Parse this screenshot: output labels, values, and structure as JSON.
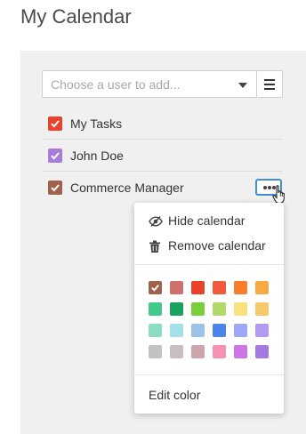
{
  "header": {
    "title": "My Calendar"
  },
  "user_picker": {
    "placeholder": "Choose a user to add..."
  },
  "calendars": [
    {
      "label": "My Tasks",
      "color": "#e8412c",
      "checked": true
    },
    {
      "label": "John Doe",
      "color": "#a67ed8",
      "checked": true
    },
    {
      "label": "Commerce Manager",
      "color": "#a0624c",
      "checked": true
    }
  ],
  "context_menu": {
    "hide_label": "Hide calendar",
    "remove_label": "Remove calendar",
    "edit_color_label": "Edit color",
    "selected_color": "#a0624c",
    "colors": [
      [
        "#a0624c",
        "#d0706c",
        "#e8412c",
        "#f05a3a",
        "#fa7d2f",
        "#f5aa44"
      ],
      [
        "#44c98c",
        "#1aa260",
        "#7bcf3c",
        "#b0d96a",
        "#f7e27e",
        "#f5c96a"
      ],
      [
        "#8cdcc4",
        "#a3e0ea",
        "#9cc2e7",
        "#4a86e8",
        "#9fa6f7",
        "#b29af2"
      ],
      [
        "#c2c2c2",
        "#cabdbf",
        "#cca6ac",
        "#f691b2",
        "#cd74e6",
        "#a47ae2"
      ]
    ]
  }
}
